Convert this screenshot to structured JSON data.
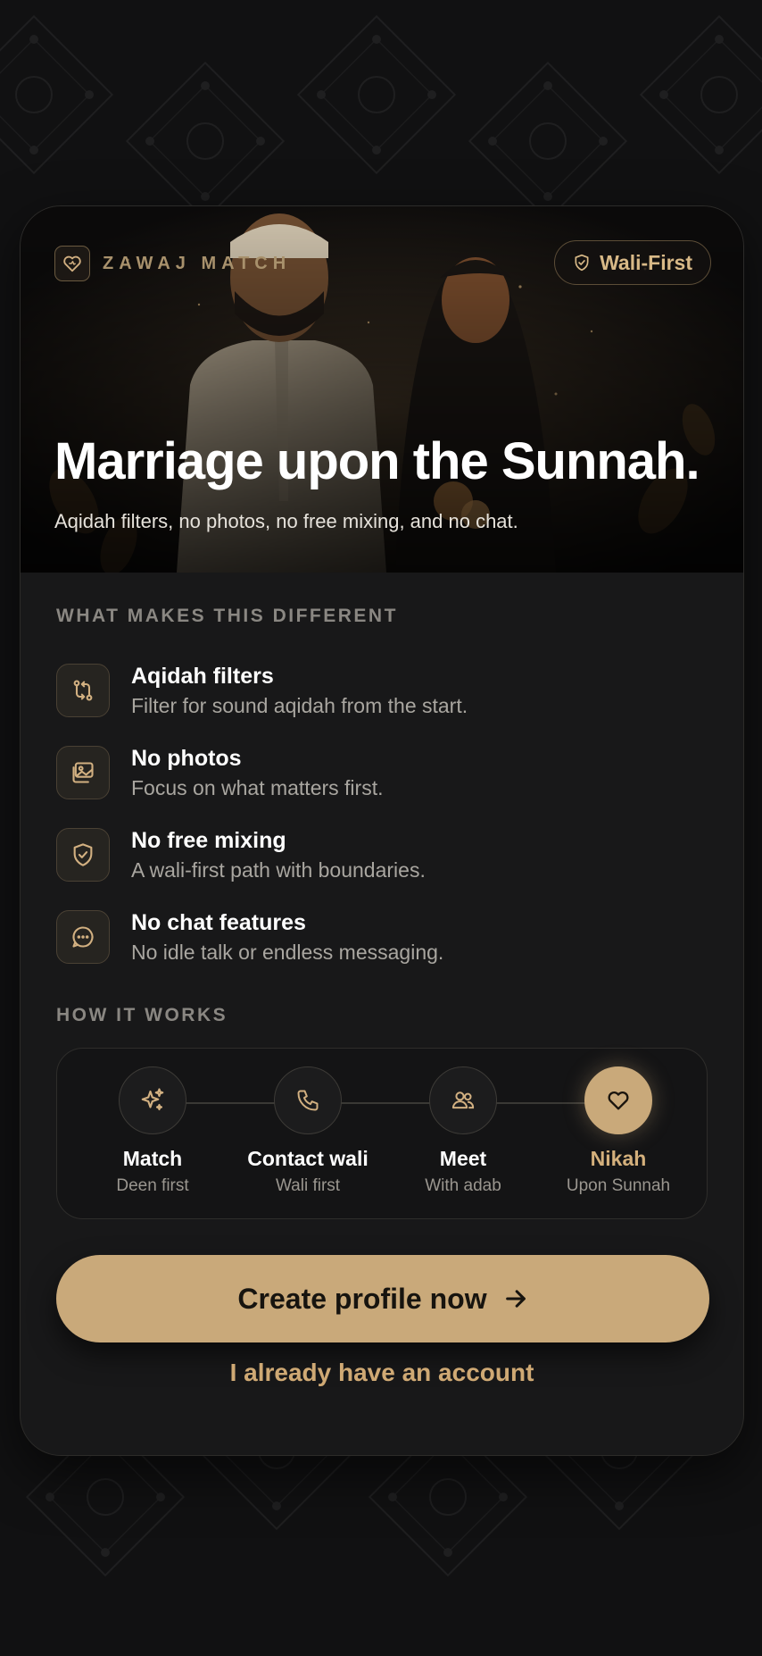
{
  "brand": {
    "name": "ZAWAJ MATCH",
    "icon": "heart-icon"
  },
  "badge": {
    "label": "Wali-First",
    "icon": "shield-check-icon"
  },
  "hero": {
    "title": "Marriage upon the Sunnah.",
    "subtitle": "Aqidah filters, no photos, no free mixing, and no chat."
  },
  "features_section": {
    "label": "WHAT MAKES THIS DIFFERENT",
    "items": [
      {
        "title": "Aqidah filters",
        "desc": "Filter for sound aqidah from the start.",
        "icon": "compare-arrows-icon"
      },
      {
        "title": "No photos",
        "desc": "Focus on what matters first.",
        "icon": "image-off-icon"
      },
      {
        "title": "No free mixing",
        "desc": "A wali-first path with boundaries.",
        "icon": "shield-check-icon"
      },
      {
        "title": "No chat features",
        "desc": "No idle talk or endless messaging.",
        "icon": "chat-bubble-icon"
      }
    ]
  },
  "how_section": {
    "label": "HOW IT WORKS",
    "steps": [
      {
        "title": "Match",
        "sub": "Deen first",
        "icon": "sparkles-icon"
      },
      {
        "title": "Contact wali",
        "sub": "Wali first",
        "icon": "phone-icon"
      },
      {
        "title": "Meet",
        "sub": "With adab",
        "icon": "users-icon"
      },
      {
        "title": "Nikah",
        "sub": "Upon Sunnah",
        "icon": "heart-icon",
        "active": true
      }
    ]
  },
  "cta": {
    "primary_label": "Create profile now",
    "secondary_label": "I already have an account"
  },
  "colors": {
    "accent": "#c9a97a",
    "background": "#111112",
    "card": "#181819"
  }
}
